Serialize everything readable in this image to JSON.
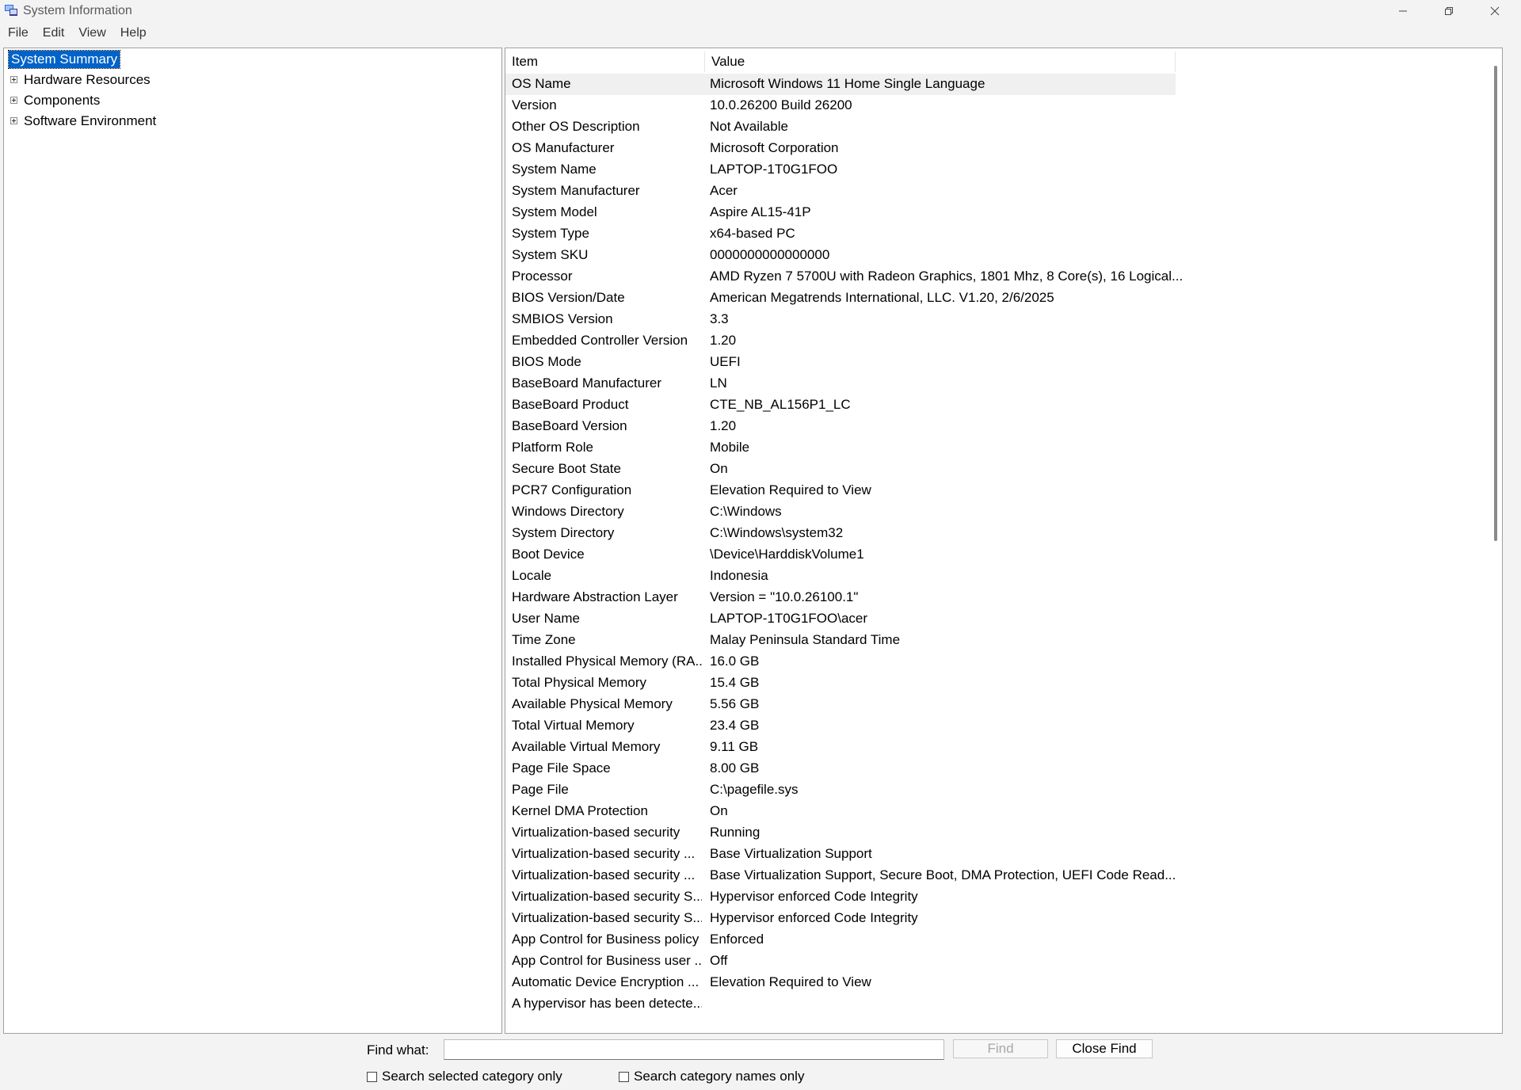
{
  "window": {
    "title": "System Information"
  },
  "menu": [
    "File",
    "Edit",
    "View",
    "Help"
  ],
  "tree": [
    {
      "label": "System Summary",
      "selected": true,
      "expander": false
    },
    {
      "label": "Hardware Resources",
      "expander": true
    },
    {
      "label": "Components",
      "expander": true
    },
    {
      "label": "Software Environment",
      "expander": true
    }
  ],
  "list": {
    "headers": {
      "item": "Item",
      "value": "Value"
    },
    "rows": [
      {
        "item": "OS Name",
        "value": "Microsoft Windows 11 Home Single Language"
      },
      {
        "item": "Version",
        "value": "10.0.26200 Build 26200"
      },
      {
        "item": "Other OS Description",
        "value": "Not Available"
      },
      {
        "item": "OS Manufacturer",
        "value": "Microsoft Corporation"
      },
      {
        "item": "System Name",
        "value": "LAPTOP-1T0G1FOO"
      },
      {
        "item": "System Manufacturer",
        "value": "Acer"
      },
      {
        "item": "System Model",
        "value": "Aspire AL15-41P"
      },
      {
        "item": "System Type",
        "value": "x64-based PC"
      },
      {
        "item": "System SKU",
        "value": "0000000000000000"
      },
      {
        "item": "Processor",
        "value": "AMD Ryzen 7 5700U with Radeon Graphics, 1801 Mhz, 8 Core(s), 16 Logical..."
      },
      {
        "item": "BIOS Version/Date",
        "value": "American Megatrends International, LLC. V1.20, 2/6/2025"
      },
      {
        "item": "SMBIOS Version",
        "value": "3.3"
      },
      {
        "item": "Embedded Controller Version",
        "value": "1.20"
      },
      {
        "item": "BIOS Mode",
        "value": "UEFI"
      },
      {
        "item": "BaseBoard Manufacturer",
        "value": "LN"
      },
      {
        "item": "BaseBoard Product",
        "value": "CTE_NB_AL156P1_LC"
      },
      {
        "item": "BaseBoard Version",
        "value": "1.20"
      },
      {
        "item": "Platform Role",
        "value": "Mobile"
      },
      {
        "item": "Secure Boot State",
        "value": "On"
      },
      {
        "item": "PCR7 Configuration",
        "value": "Elevation Required to View"
      },
      {
        "item": "Windows Directory",
        "value": "C:\\Windows"
      },
      {
        "item": "System Directory",
        "value": "C:\\Windows\\system32"
      },
      {
        "item": "Boot Device",
        "value": "\\Device\\HarddiskVolume1"
      },
      {
        "item": "Locale",
        "value": "Indonesia"
      },
      {
        "item": "Hardware Abstraction Layer",
        "value": "Version = \"10.0.26100.1\""
      },
      {
        "item": "User Name",
        "value": "LAPTOP-1T0G1FOO\\acer"
      },
      {
        "item": "Time Zone",
        "value": "Malay Peninsula Standard Time"
      },
      {
        "item": "Installed Physical Memory (RA...",
        "value": "16.0 GB"
      },
      {
        "item": "Total Physical Memory",
        "value": "15.4 GB"
      },
      {
        "item": "Available Physical Memory",
        "value": "5.56 GB"
      },
      {
        "item": "Total Virtual Memory",
        "value": "23.4 GB"
      },
      {
        "item": "Available Virtual Memory",
        "value": "9.11 GB"
      },
      {
        "item": "Page File Space",
        "value": "8.00 GB"
      },
      {
        "item": "Page File",
        "value": "C:\\pagefile.sys"
      },
      {
        "item": "Kernel DMA Protection",
        "value": "On"
      },
      {
        "item": "Virtualization-based security",
        "value": "Running"
      },
      {
        "item": "Virtualization-based security ...",
        "value": "Base Virtualization Support"
      },
      {
        "item": "Virtualization-based security ...",
        "value": "Base Virtualization Support, Secure Boot, DMA Protection, UEFI Code Read..."
      },
      {
        "item": "Virtualization-based security S...",
        "value": "Hypervisor enforced Code Integrity"
      },
      {
        "item": "Virtualization-based security S...",
        "value": "Hypervisor enforced Code Integrity"
      },
      {
        "item": "App Control for Business policy",
        "value": "Enforced"
      },
      {
        "item": "App Control for Business user ...",
        "value": "Off"
      },
      {
        "item": "Automatic Device Encryption ...",
        "value": "Elevation Required to View"
      },
      {
        "item": "A hypervisor has been detecte...",
        "value": ""
      }
    ]
  },
  "find": {
    "label": "Find what:",
    "value": "",
    "find_button": "Find",
    "close_button": "Close Find",
    "check_selected": "Search selected category only",
    "check_names": "Search category names only"
  },
  "colors": {
    "selection": "#0063c9",
    "window_bg": "#f3f3f3"
  }
}
